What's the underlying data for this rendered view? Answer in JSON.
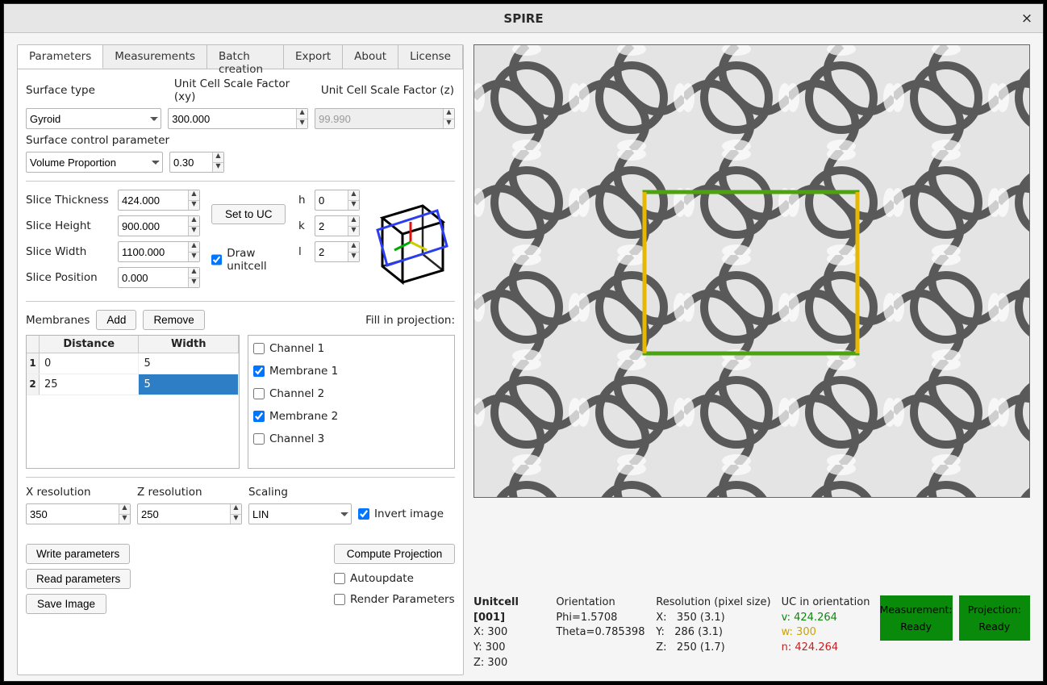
{
  "window": {
    "title": "SPIRE"
  },
  "tabs": [
    "Parameters",
    "Measurements",
    "Batch creation",
    "Export",
    "About",
    "License"
  ],
  "active_tab": 0,
  "surface": {
    "type_label": "Surface type",
    "type_value": "Gyroid",
    "xy_label": "Unit Cell Scale Factor (xy)",
    "xy_value": "300.000",
    "z_label": "Unit Cell Scale Factor  (z)",
    "z_value": "99.990",
    "ctrl_label": "Surface control parameter",
    "ctrl_mode": "Volume Proportion",
    "ctrl_value": "0.30"
  },
  "slice": {
    "thickness_label": "Slice Thickness",
    "thickness": "424.000",
    "height_label": "Slice Height",
    "height": "900.000",
    "width_label": "Slice Width",
    "width": "1100.000",
    "position_label": "Slice Position",
    "position": "0.000",
    "set_to_uc": "Set to UC",
    "draw_unitcell_label": "Draw unitcell",
    "draw_unitcell": true,
    "h_label": "h",
    "h": "0",
    "k_label": "k",
    "k": "2",
    "l_label": "l",
    "l": "2"
  },
  "membranes": {
    "label": "Membranes",
    "add": "Add",
    "remove": "Remove",
    "fill_label": "Fill in projection:",
    "cols": {
      "distance": "Distance",
      "width": "Width"
    },
    "rows": [
      {
        "n": "1",
        "distance": "0",
        "width": "5"
      },
      {
        "n": "2",
        "distance": "25",
        "width": "5"
      }
    ],
    "options": [
      {
        "label": "Channel 1",
        "checked": false
      },
      {
        "label": "Membrane 1",
        "checked": true
      },
      {
        "label": "Channel 2",
        "checked": false
      },
      {
        "label": "Membrane 2",
        "checked": true
      },
      {
        "label": "Channel 3",
        "checked": false
      }
    ]
  },
  "resolution": {
    "x_label": "X resolution",
    "x": "350",
    "z_label": "Z resolution",
    "z": "250",
    "scaling_label": "Scaling",
    "scaling": "LIN",
    "invert_label": "Invert image",
    "invert": true
  },
  "actions": {
    "write": "Write parameters",
    "read": "Read parameters",
    "save": "Save Image",
    "compute": "Compute Projection",
    "autoupdate_label": "Autoupdate",
    "autoupdate": false,
    "render_label": "Render Parameters",
    "render": false
  },
  "status": {
    "unitcell_title": "Unitcell [001]",
    "uc_x": "X: 300",
    "uc_y": "Y: 300",
    "uc_z": "Z: 300",
    "orient_title": "Orientation",
    "phi": "Phi=1.5708",
    "theta": "Theta=0.785398",
    "res_title": "Resolution (pixel size)",
    "res_x": "X:   350 (3.1)",
    "res_y": "Y:   286 (3.1)",
    "res_z": "Z:   250 (1.7)",
    "uco_title": "UC in orientation",
    "uco_v": "v: 424.264",
    "uco_w": "w: 300",
    "uco_n": "n: 424.264",
    "measure": "Measurement:",
    "measure_state": "Ready",
    "proj": "Projection:",
    "proj_state": "Ready"
  }
}
